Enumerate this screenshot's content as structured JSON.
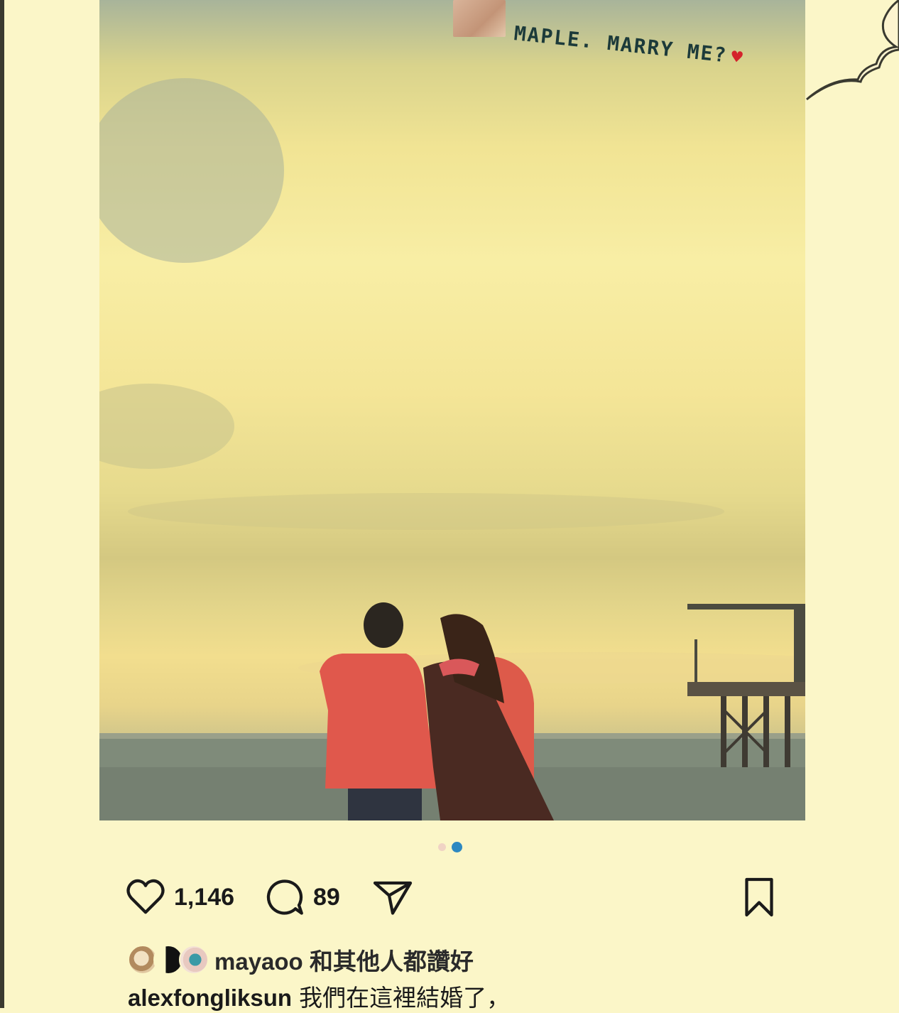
{
  "post": {
    "banner_text": "MAPLE. MARRY ME?",
    "banner_heart": "♥",
    "carousel": {
      "total": 2,
      "active_index": 2
    }
  },
  "actions": {
    "likes": "1,146",
    "comments": "89",
    "icons": [
      "heart-icon",
      "comment-icon",
      "share-icon",
      "bookmark-icon"
    ]
  },
  "liked_by": {
    "username": "mayaoo",
    "suffix": "和其他人都讚好"
  },
  "caption": {
    "username": "alexfongliksun",
    "text": "我們在這裡結婚了，"
  },
  "colors": {
    "background": "#fbf6c8",
    "text": "#1a1a1a",
    "active_dot": "#2d88c1"
  }
}
